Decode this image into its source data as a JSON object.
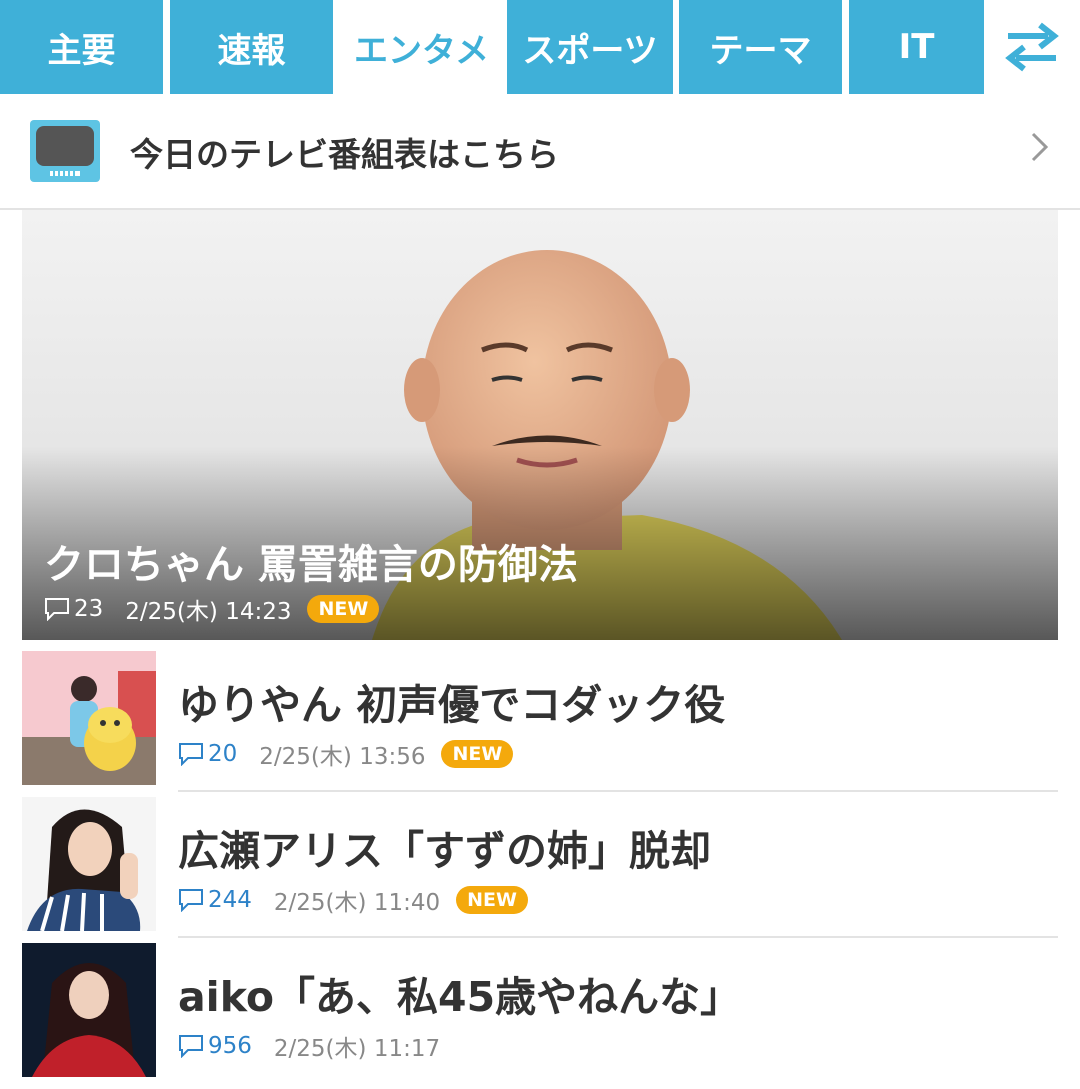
{
  "tabs": [
    {
      "label": "主要",
      "active": false
    },
    {
      "label": "速報",
      "active": false
    },
    {
      "label": "エンタメ",
      "active": true
    },
    {
      "label": "スポーツ",
      "active": false
    },
    {
      "label": "テーマ",
      "active": false
    },
    {
      "label": "IT",
      "active": false
    }
  ],
  "tv_link": {
    "label": "今日のテレビ番組表はこちら"
  },
  "hero": {
    "title": "クロちゃん 罵詈雑言の防御法",
    "comments": "23",
    "datetime": "2/25(木) 14:23",
    "badge": "NEW"
  },
  "articles": [
    {
      "title": "ゆりやん 初声優でコダック役",
      "comments": "20",
      "datetime": "2/25(木) 13:56",
      "badge": "NEW"
    },
    {
      "title": "広瀬アリス「すずの姉」脱却",
      "comments": "244",
      "datetime": "2/25(木) 11:40",
      "badge": "NEW"
    },
    {
      "title": "aiko「あ、私45歳やねんな」",
      "comments": "956",
      "datetime": "2/25(木) 11:17",
      "badge": ""
    }
  ],
  "colors": {
    "accent": "#3fb0d8",
    "badge": "#f4a90c",
    "comment_count": "#2d82c8"
  }
}
